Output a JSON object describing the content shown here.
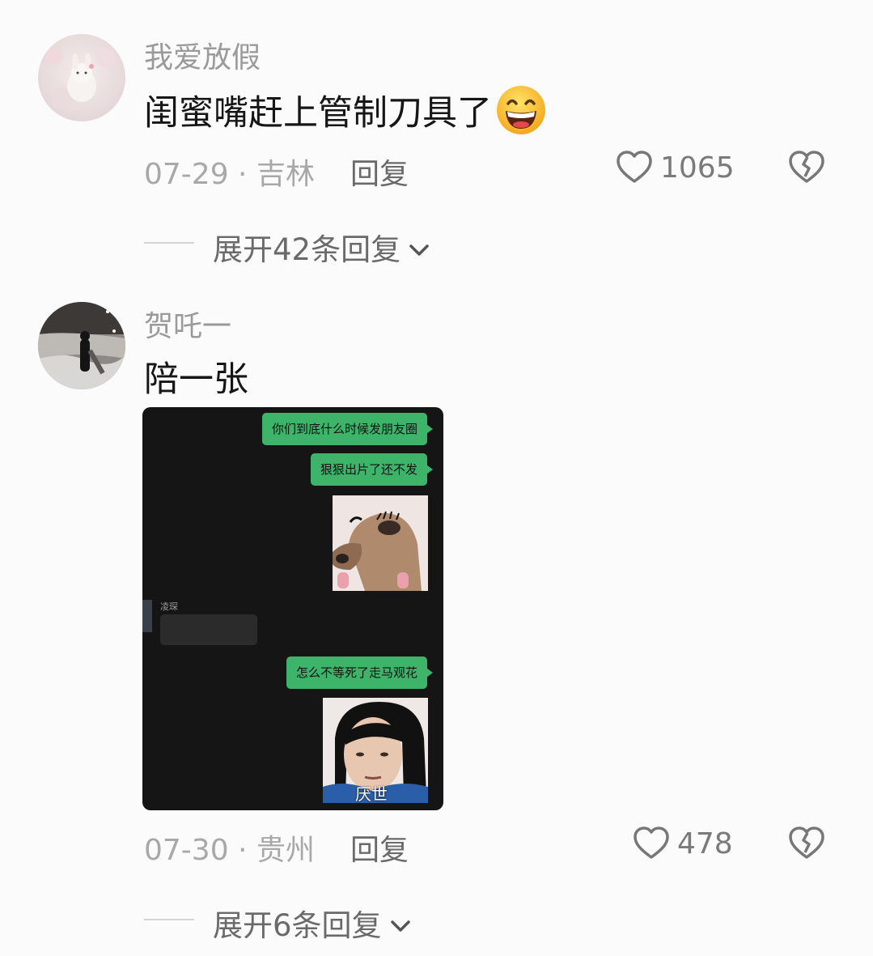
{
  "comments": [
    {
      "username": "我爱放假",
      "text": "闺蜜嘴赶上管制刀具了",
      "emoji": "grinning-face-icon",
      "date_location": "07-29 · 吉林",
      "reply_label": "回复",
      "likes": "1065",
      "expand_label": "展开42条回复"
    },
    {
      "username": "贺吒一",
      "text": "陪一张",
      "date_location": "07-30 · 贵州",
      "reply_label": "回复",
      "likes": "478",
      "expand_label": "展开6条回复",
      "image": {
        "messages": [
          "你们到底什么时候发朋友圈",
          "狠狠出片了还不发",
          "怎么不等死了走马观花"
        ],
        "other_sender": "凌琛",
        "sticker_caption": "厌世"
      }
    }
  ],
  "colors": {
    "bubble": "#3eb36a",
    "bg": "#fbfbfb",
    "muted": "#a8a8a8"
  }
}
